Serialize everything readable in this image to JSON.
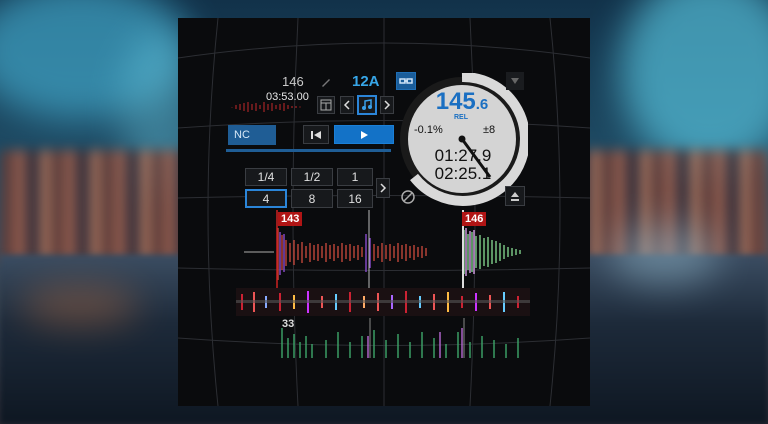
{
  "deck": {
    "bpm": "146",
    "time": "03:53.00",
    "key": "12A",
    "sync_label": "NC",
    "platter": {
      "bpm_main": "145",
      "bpm_decimal": ".6",
      "rel_label": "REL",
      "pitch": "-0.1%",
      "pitch_range": "±8",
      "elapsed": "01:27.9",
      "remaining": "02:25.1"
    },
    "loop_sizes_row1": [
      "1/4",
      "1/2",
      "1"
    ],
    "loop_sizes_row2": [
      "4",
      "8",
      "16"
    ],
    "selected_loop": "4"
  },
  "waveform": {
    "cue_markers": [
      "143",
      "146"
    ],
    "beat_marker": "33"
  },
  "colors": {
    "accent": "#1372c7",
    "key_color": "#37a6e8",
    "cue_marker": "#b01515",
    "platter_ring": "#d9d9d9"
  }
}
